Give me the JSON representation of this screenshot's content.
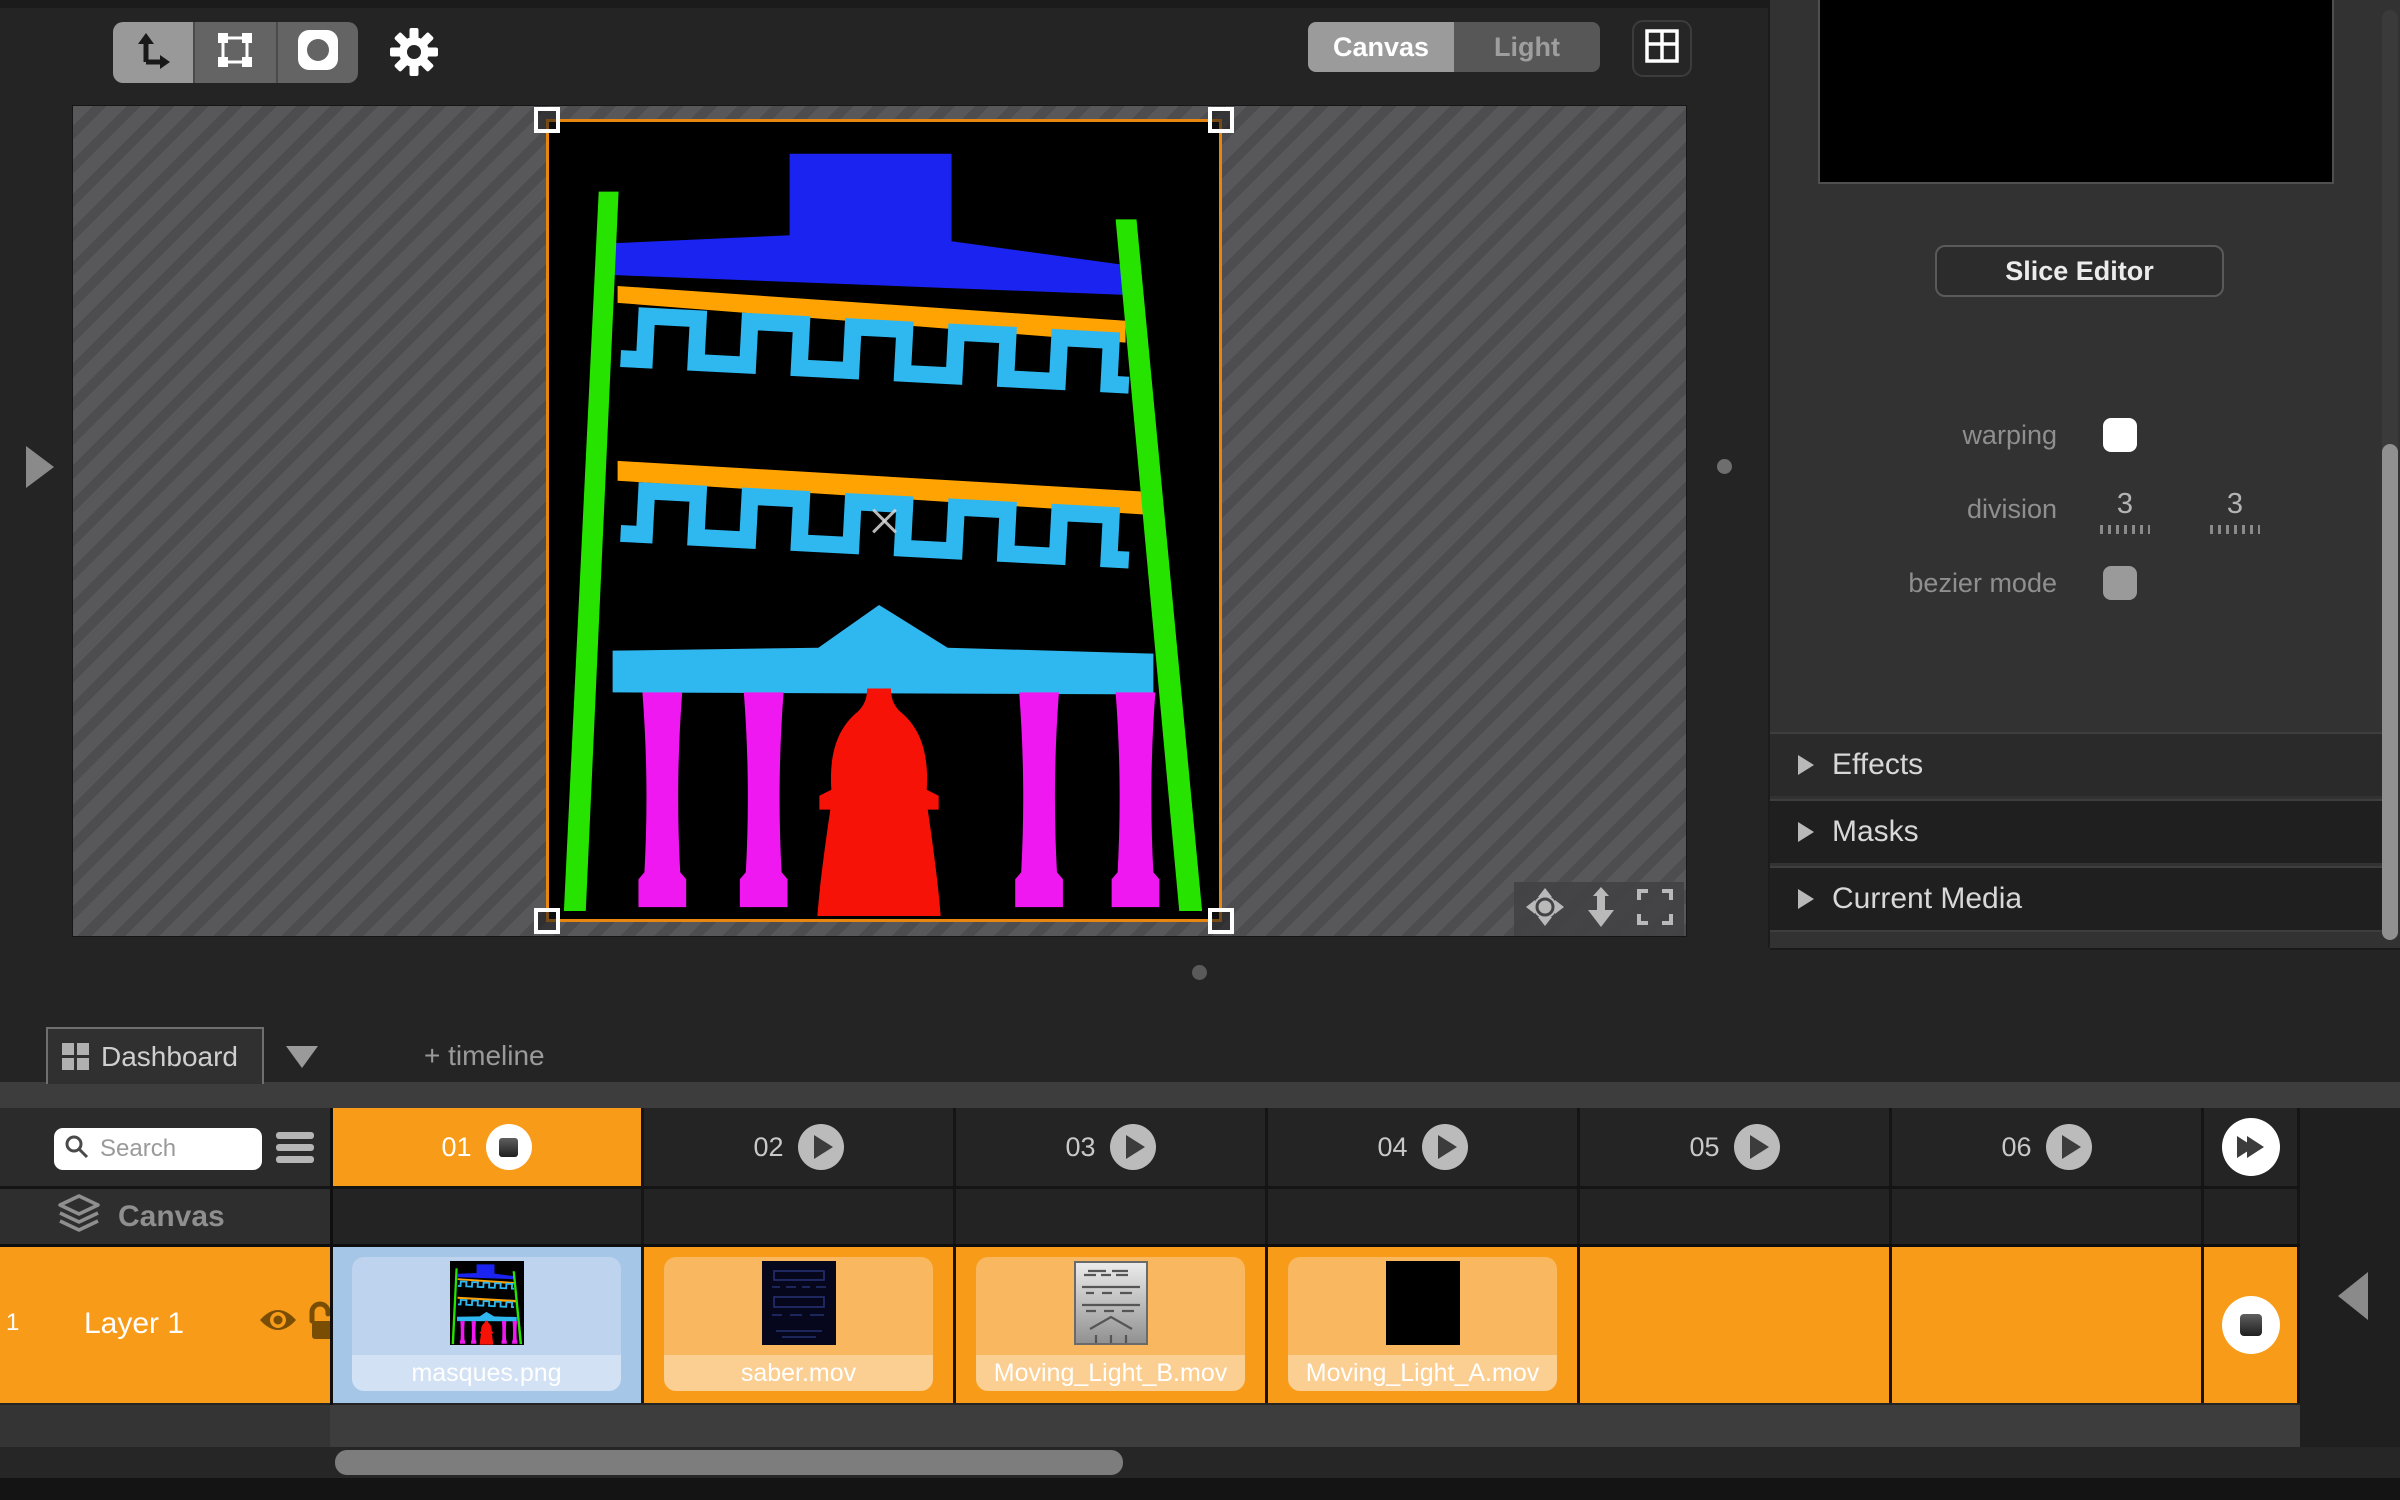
{
  "toolbar": {
    "tools": [
      {
        "name": "move-tool",
        "selected": true
      },
      {
        "name": "transform-tool",
        "selected": false
      },
      {
        "name": "mask-tool",
        "selected": false
      }
    ],
    "view_toggle": {
      "options": [
        "Canvas",
        "Light"
      ],
      "selected": "Canvas"
    }
  },
  "right_panel": {
    "slice_editor_label": "Slice Editor",
    "warping_label": "warping",
    "warping_checked": false,
    "division_label": "division",
    "division_values": [
      "3",
      "3"
    ],
    "bezier_mode_label": "bezier mode",
    "bezier_mode_checked": false,
    "sections": [
      {
        "label": "Effects"
      },
      {
        "label": "Masks"
      },
      {
        "label": "Current Media"
      }
    ]
  },
  "dashboard_bar": {
    "tab_label": "Dashboard",
    "add_timeline_label": "+ timeline"
  },
  "grid": {
    "search": {
      "placeholder": "Search"
    },
    "columns": [
      {
        "label": "01",
        "state": "active-stop"
      },
      {
        "label": "02",
        "state": "play"
      },
      {
        "label": "03",
        "state": "play"
      },
      {
        "label": "04",
        "state": "play"
      },
      {
        "label": "05",
        "state": "play"
      },
      {
        "label": "06",
        "state": "play"
      }
    ],
    "canvas_row_label": "Canvas",
    "layer": {
      "index": "1",
      "name": "Layer 1",
      "visible": true,
      "locked": false
    },
    "cells": [
      {
        "label": "masques.png",
        "selected": true
      },
      {
        "label": "saber.mov",
        "selected": false
      },
      {
        "label": "Moving_Light_B.mov",
        "selected": false
      },
      {
        "label": "Moving_Light_A.mov",
        "selected": false
      }
    ]
  },
  "colors": {
    "accent_orange": "#F79B18",
    "selection_border_orange": "#E8870F",
    "selected_cell_blue": "#A6C6E8",
    "facade_green": "#26E400",
    "facade_blue": "#1A23F0",
    "facade_orange": "#FFA303",
    "facade_cyan": "#2FB7EF",
    "facade_magenta": "#F018F0",
    "facade_red": "#F71208"
  },
  "icons": {
    "move_tool": "corner-arrows",
    "transform_tool": "frame-handles",
    "mask_tool": "rounded-square-hole",
    "settings": "gear",
    "window_layout": "grid-2x2",
    "pan": "four-way-arrows",
    "fit_height": "down-arrow",
    "fullscreen": "corner-brackets",
    "layer_visibility": "eye",
    "layer_lock": "open-padlock",
    "canvas_row": "stacked-layers",
    "fast_forward": "double-play"
  }
}
